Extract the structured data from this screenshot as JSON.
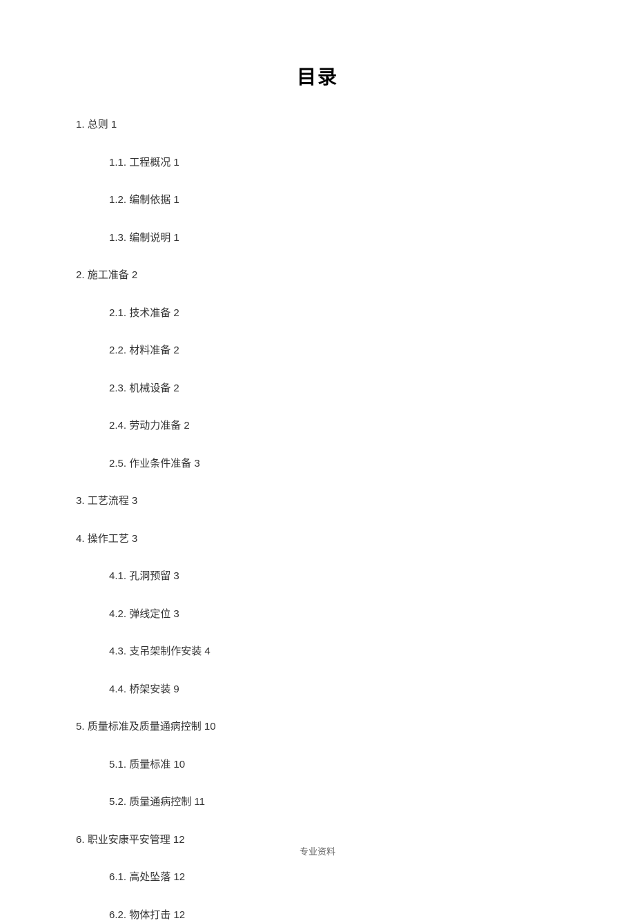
{
  "title": "目录",
  "toc": [
    {
      "level": 1,
      "number": "1.",
      "text": "总则",
      "page": "1"
    },
    {
      "level": 2,
      "number": "1.1.",
      "text": "工程概况",
      "page": "1"
    },
    {
      "level": 2,
      "number": "1.2.",
      "text": "编制依据",
      "page": "1"
    },
    {
      "level": 2,
      "number": "1.3.",
      "text": "编制说明",
      "page": "1"
    },
    {
      "level": 1,
      "number": "2.",
      "text": "施工准备",
      "page": "2"
    },
    {
      "level": 2,
      "number": "2.1.",
      "text": "技术准备",
      "page": "2"
    },
    {
      "level": 2,
      "number": "2.2.",
      "text": "材料准备",
      "page": "2"
    },
    {
      "level": 2,
      "number": "2.3.",
      "text": "机械设备",
      "page": "2"
    },
    {
      "level": 2,
      "number": "2.4.",
      "text": "劳动力准备",
      "page": "2"
    },
    {
      "level": 2,
      "number": "2.5.",
      "text": "作业条件准备",
      "page": "3"
    },
    {
      "level": 1,
      "number": "3.",
      "text": "工艺流程",
      "page": "3"
    },
    {
      "level": 1,
      "number": "4.",
      "text": "操作工艺",
      "page": "3"
    },
    {
      "level": 2,
      "number": "4.1.",
      "text": "孔洞预留",
      "page": "3"
    },
    {
      "level": 2,
      "number": "4.2.",
      "text": "弹线定位",
      "page": "3"
    },
    {
      "level": 2,
      "number": "4.3.",
      "text": "支吊架制作安装",
      "page": "4"
    },
    {
      "level": 2,
      "number": "4.4.",
      "text": "桥架安装",
      "page": "9"
    },
    {
      "level": 1,
      "number": "5.",
      "text": "质量标准及质量通病控制",
      "page": "10"
    },
    {
      "level": 2,
      "number": "5.1.",
      "text": "质量标准",
      "page": "10"
    },
    {
      "level": 2,
      "number": "5.2.",
      "text": "质量通病控制",
      "page": "11"
    },
    {
      "level": 1,
      "number": "6.",
      "text": "职业安康平安管理",
      "page": "12"
    },
    {
      "level": 2,
      "number": "6.1.",
      "text": "高处坠落",
      "page": "12"
    },
    {
      "level": 2,
      "number": "6.2.",
      "text": "物体打击",
      "page": "12"
    }
  ],
  "footer": "专业资料"
}
